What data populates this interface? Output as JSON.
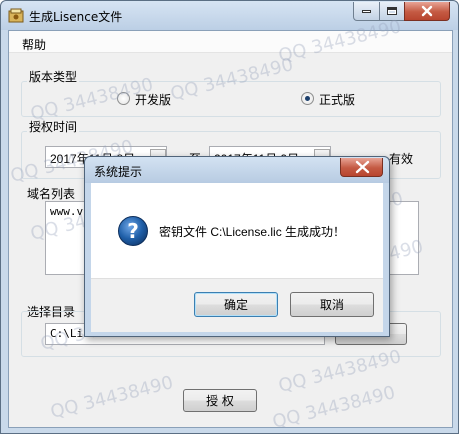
{
  "window": {
    "title": "生成Lisence文件"
  },
  "menu": {
    "help": "帮助"
  },
  "version_group": {
    "label": "版本类型",
    "options": [
      {
        "label": "开发版",
        "checked": false
      },
      {
        "label": "正式版",
        "checked": true
      }
    ]
  },
  "auth_time": {
    "label": "授权时间",
    "start_date": "2017年11月 8日",
    "separator": "至",
    "end_date": "2017年11月 9日",
    "suffix": "有效"
  },
  "domain_list": {
    "label": "域名列表",
    "value": "www.v"
  },
  "directory": {
    "label": "选择目录",
    "value": "C:\\Lic"
  },
  "authorize_button": "授  权",
  "watermark_text": "QQ 34438490",
  "dialog": {
    "title": "系统提示",
    "message": "密钥文件 C:\\License.lic 生成成功！",
    "ok_label": "确定",
    "cancel_label": "取消"
  },
  "icons": {
    "app": "app-icon",
    "question": "question-icon"
  },
  "colors": {
    "titlebar": "#bccfe5",
    "close_button": "#c45a43",
    "question_icon": "#1f5fa8"
  }
}
